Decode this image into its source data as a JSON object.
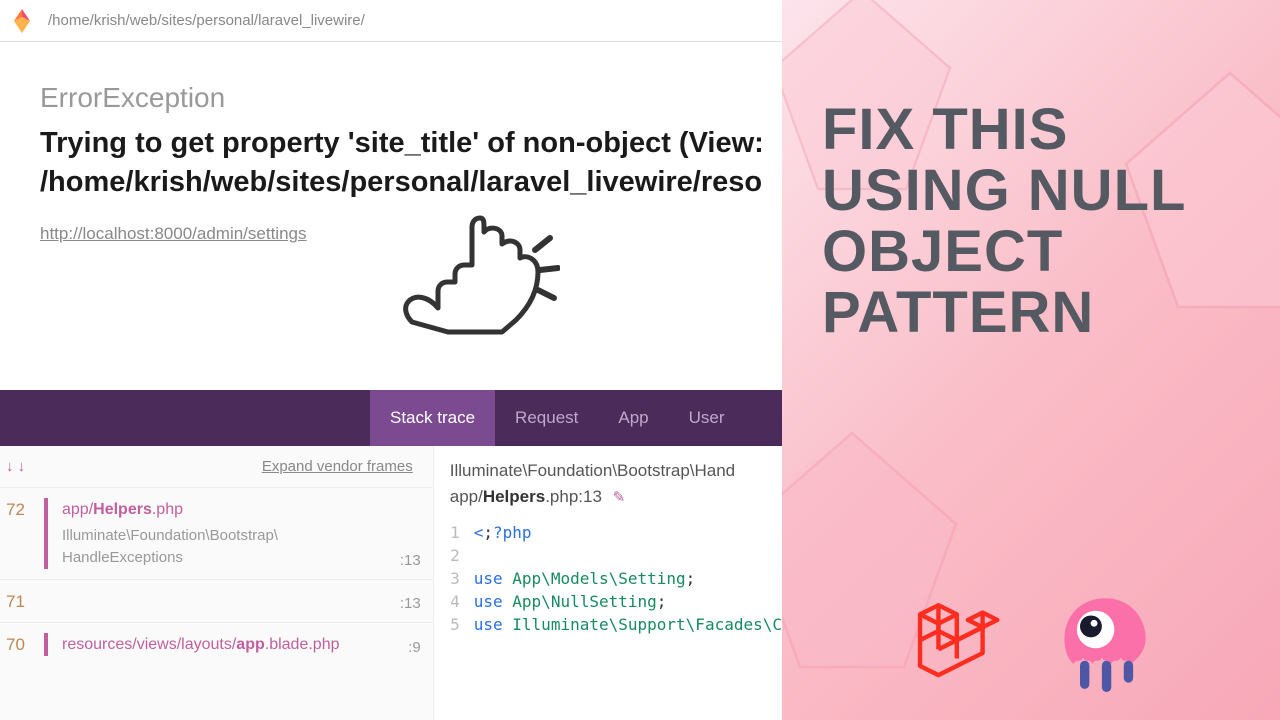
{
  "path_bar": {
    "text": "/home/krish/web/sites/personal/laravel_livewire/"
  },
  "error": {
    "exception": "ErrorException",
    "message": "Trying to get property 'site_title' of non-object (View: /home/krish/web/sites/personal/laravel_livewire/reso",
    "url": "http://localhost:8000/admin/settings"
  },
  "tabs": {
    "stack_trace": "Stack trace",
    "request": "Request",
    "app": "App",
    "user": "User"
  },
  "frames": {
    "expand_label": "Expand vendor frames",
    "items": [
      {
        "num": "72",
        "path_prefix": "app/",
        "path_bold": "Helpers",
        "path_suffix": ".php",
        "sub": "Illuminate\\Foundation\\Bootstrap\\ HandleExceptions",
        "line": ":13",
        "active": true
      },
      {
        "num": "71",
        "path_prefix": "",
        "path_bold": "",
        "path_suffix": "",
        "sub": "",
        "line": ":13",
        "active": false
      },
      {
        "num": "70",
        "path_prefix": "resources/views/layouts/",
        "path_bold": "app",
        "path_suffix": ".blade.php",
        "sub": "",
        "line": ":9",
        "active": true
      }
    ]
  },
  "code": {
    "header_ns": "Illuminate\\Foundation\\Bootstrap\\Hand",
    "header_file_prefix": "app/",
    "header_file_bold": "Helpers",
    "header_file_suffix": ".php:13",
    "edit_icon": "✎",
    "lines": [
      {
        "n": "1",
        "raw": "<?php"
      },
      {
        "n": "2",
        "raw": ""
      },
      {
        "n": "3",
        "raw": "use App\\Models\\Setting;"
      },
      {
        "n": "4",
        "raw": "use App\\NullSetting;"
      },
      {
        "n": "5",
        "raw": "use Illuminate\\Support\\Facades\\C"
      }
    ]
  },
  "promo": {
    "text": "FIX THIS USING NULL OBJECT PATTERN"
  },
  "colors": {
    "tab_bg": "#4a2b59",
    "tab_active": "#7b4a90",
    "accent": "#c060a0",
    "laravel": "#ff2d20",
    "livewire": "#fb70a9"
  }
}
